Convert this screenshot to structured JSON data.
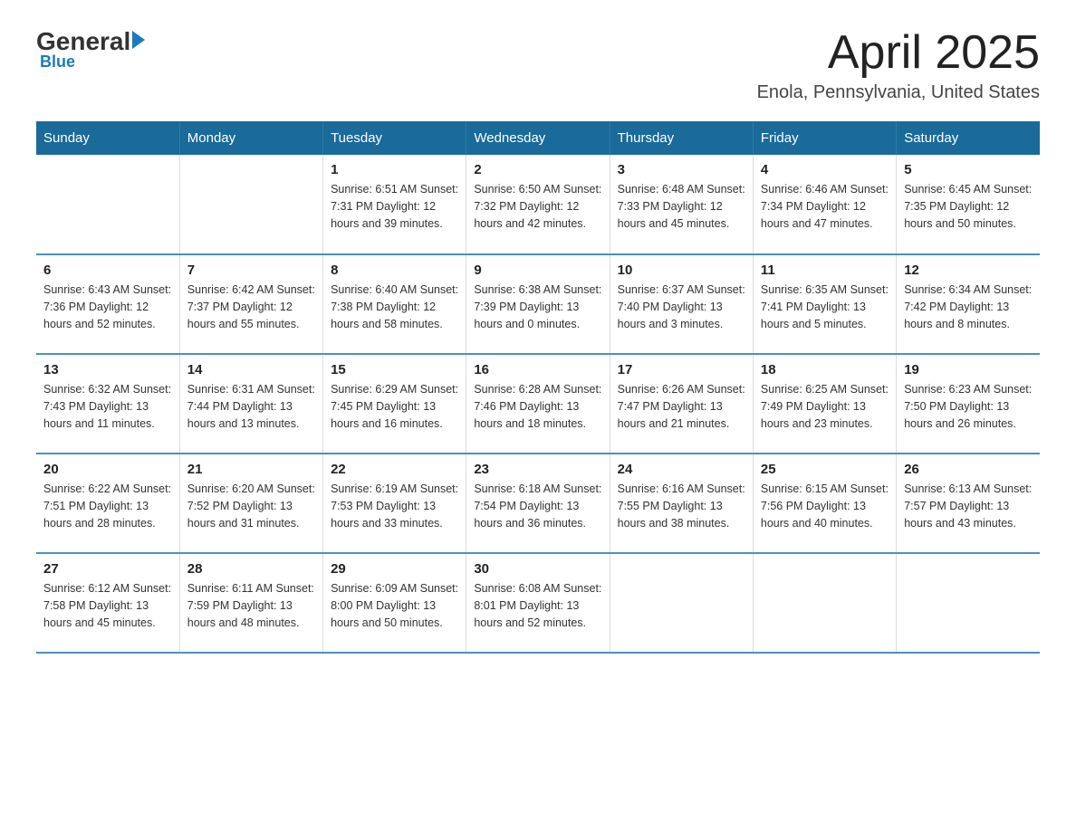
{
  "logo": {
    "general": "General",
    "blue": "Blue",
    "sub": "Blue"
  },
  "header": {
    "title": "April 2025",
    "subtitle": "Enola, Pennsylvania, United States"
  },
  "weekdays": [
    "Sunday",
    "Monday",
    "Tuesday",
    "Wednesday",
    "Thursday",
    "Friday",
    "Saturday"
  ],
  "weeks": [
    [
      {
        "day": "",
        "info": ""
      },
      {
        "day": "",
        "info": ""
      },
      {
        "day": "1",
        "info": "Sunrise: 6:51 AM\nSunset: 7:31 PM\nDaylight: 12 hours\nand 39 minutes."
      },
      {
        "day": "2",
        "info": "Sunrise: 6:50 AM\nSunset: 7:32 PM\nDaylight: 12 hours\nand 42 minutes."
      },
      {
        "day": "3",
        "info": "Sunrise: 6:48 AM\nSunset: 7:33 PM\nDaylight: 12 hours\nand 45 minutes."
      },
      {
        "day": "4",
        "info": "Sunrise: 6:46 AM\nSunset: 7:34 PM\nDaylight: 12 hours\nand 47 minutes."
      },
      {
        "day": "5",
        "info": "Sunrise: 6:45 AM\nSunset: 7:35 PM\nDaylight: 12 hours\nand 50 minutes."
      }
    ],
    [
      {
        "day": "6",
        "info": "Sunrise: 6:43 AM\nSunset: 7:36 PM\nDaylight: 12 hours\nand 52 minutes."
      },
      {
        "day": "7",
        "info": "Sunrise: 6:42 AM\nSunset: 7:37 PM\nDaylight: 12 hours\nand 55 minutes."
      },
      {
        "day": "8",
        "info": "Sunrise: 6:40 AM\nSunset: 7:38 PM\nDaylight: 12 hours\nand 58 minutes."
      },
      {
        "day": "9",
        "info": "Sunrise: 6:38 AM\nSunset: 7:39 PM\nDaylight: 13 hours\nand 0 minutes."
      },
      {
        "day": "10",
        "info": "Sunrise: 6:37 AM\nSunset: 7:40 PM\nDaylight: 13 hours\nand 3 minutes."
      },
      {
        "day": "11",
        "info": "Sunrise: 6:35 AM\nSunset: 7:41 PM\nDaylight: 13 hours\nand 5 minutes."
      },
      {
        "day": "12",
        "info": "Sunrise: 6:34 AM\nSunset: 7:42 PM\nDaylight: 13 hours\nand 8 minutes."
      }
    ],
    [
      {
        "day": "13",
        "info": "Sunrise: 6:32 AM\nSunset: 7:43 PM\nDaylight: 13 hours\nand 11 minutes."
      },
      {
        "day": "14",
        "info": "Sunrise: 6:31 AM\nSunset: 7:44 PM\nDaylight: 13 hours\nand 13 minutes."
      },
      {
        "day": "15",
        "info": "Sunrise: 6:29 AM\nSunset: 7:45 PM\nDaylight: 13 hours\nand 16 minutes."
      },
      {
        "day": "16",
        "info": "Sunrise: 6:28 AM\nSunset: 7:46 PM\nDaylight: 13 hours\nand 18 minutes."
      },
      {
        "day": "17",
        "info": "Sunrise: 6:26 AM\nSunset: 7:47 PM\nDaylight: 13 hours\nand 21 minutes."
      },
      {
        "day": "18",
        "info": "Sunrise: 6:25 AM\nSunset: 7:49 PM\nDaylight: 13 hours\nand 23 minutes."
      },
      {
        "day": "19",
        "info": "Sunrise: 6:23 AM\nSunset: 7:50 PM\nDaylight: 13 hours\nand 26 minutes."
      }
    ],
    [
      {
        "day": "20",
        "info": "Sunrise: 6:22 AM\nSunset: 7:51 PM\nDaylight: 13 hours\nand 28 minutes."
      },
      {
        "day": "21",
        "info": "Sunrise: 6:20 AM\nSunset: 7:52 PM\nDaylight: 13 hours\nand 31 minutes."
      },
      {
        "day": "22",
        "info": "Sunrise: 6:19 AM\nSunset: 7:53 PM\nDaylight: 13 hours\nand 33 minutes."
      },
      {
        "day": "23",
        "info": "Sunrise: 6:18 AM\nSunset: 7:54 PM\nDaylight: 13 hours\nand 36 minutes."
      },
      {
        "day": "24",
        "info": "Sunrise: 6:16 AM\nSunset: 7:55 PM\nDaylight: 13 hours\nand 38 minutes."
      },
      {
        "day": "25",
        "info": "Sunrise: 6:15 AM\nSunset: 7:56 PM\nDaylight: 13 hours\nand 40 minutes."
      },
      {
        "day": "26",
        "info": "Sunrise: 6:13 AM\nSunset: 7:57 PM\nDaylight: 13 hours\nand 43 minutes."
      }
    ],
    [
      {
        "day": "27",
        "info": "Sunrise: 6:12 AM\nSunset: 7:58 PM\nDaylight: 13 hours\nand 45 minutes."
      },
      {
        "day": "28",
        "info": "Sunrise: 6:11 AM\nSunset: 7:59 PM\nDaylight: 13 hours\nand 48 minutes."
      },
      {
        "day": "29",
        "info": "Sunrise: 6:09 AM\nSunset: 8:00 PM\nDaylight: 13 hours\nand 50 minutes."
      },
      {
        "day": "30",
        "info": "Sunrise: 6:08 AM\nSunset: 8:01 PM\nDaylight: 13 hours\nand 52 minutes."
      },
      {
        "day": "",
        "info": ""
      },
      {
        "day": "",
        "info": ""
      },
      {
        "day": "",
        "info": ""
      }
    ]
  ]
}
